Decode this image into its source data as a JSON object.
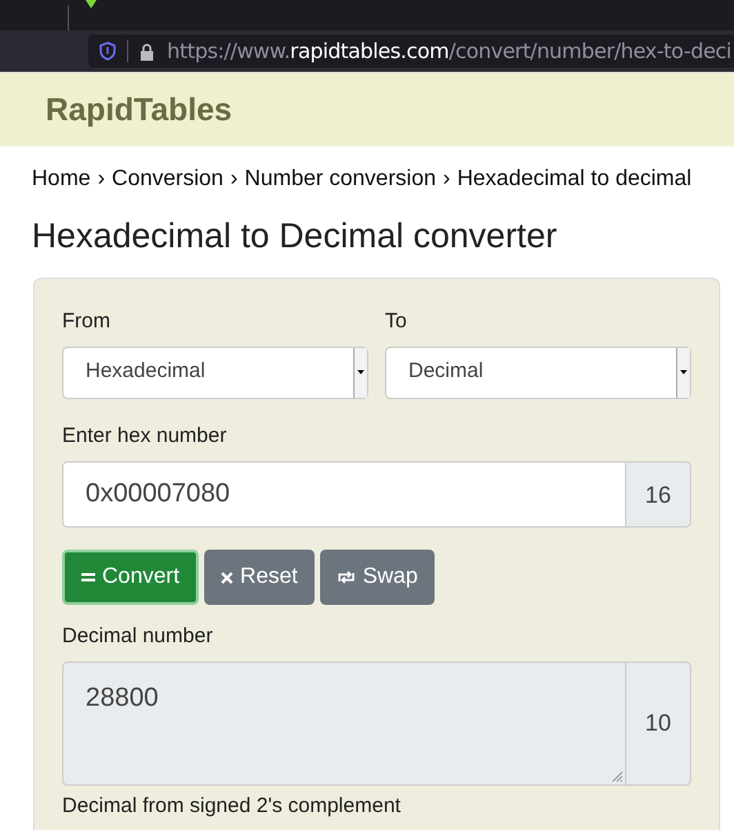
{
  "browser": {
    "url_prefix": "https://www.",
    "url_domain": "rapidtables.com",
    "url_path": "/convert/number/hex-to-deci"
  },
  "site": {
    "title": "RapidTables"
  },
  "breadcrumb": [
    {
      "label": "Home"
    },
    {
      "label": "Conversion",
      "separator": "›"
    },
    {
      "label": "Number conversion",
      "separator": "›"
    },
    {
      "label": "Hexadecimal to decimal",
      "separator": "›"
    }
  ],
  "heading": "Hexadecimal to Decimal converter",
  "from": {
    "label": "From",
    "value": "Hexadecimal"
  },
  "to": {
    "label": "To",
    "value": "Decimal"
  },
  "input": {
    "label": "Enter hex number",
    "value": "0x00007080",
    "base": "16"
  },
  "buttons": [
    {
      "kind": "convert",
      "label": "Convert"
    },
    {
      "kind": "reset",
      "label": "Reset"
    },
    {
      "kind": "swap",
      "label": "Swap"
    }
  ],
  "output": {
    "label": "Decimal number",
    "value": "28800",
    "base": "10"
  },
  "next_label": "Decimal from signed 2's complement"
}
